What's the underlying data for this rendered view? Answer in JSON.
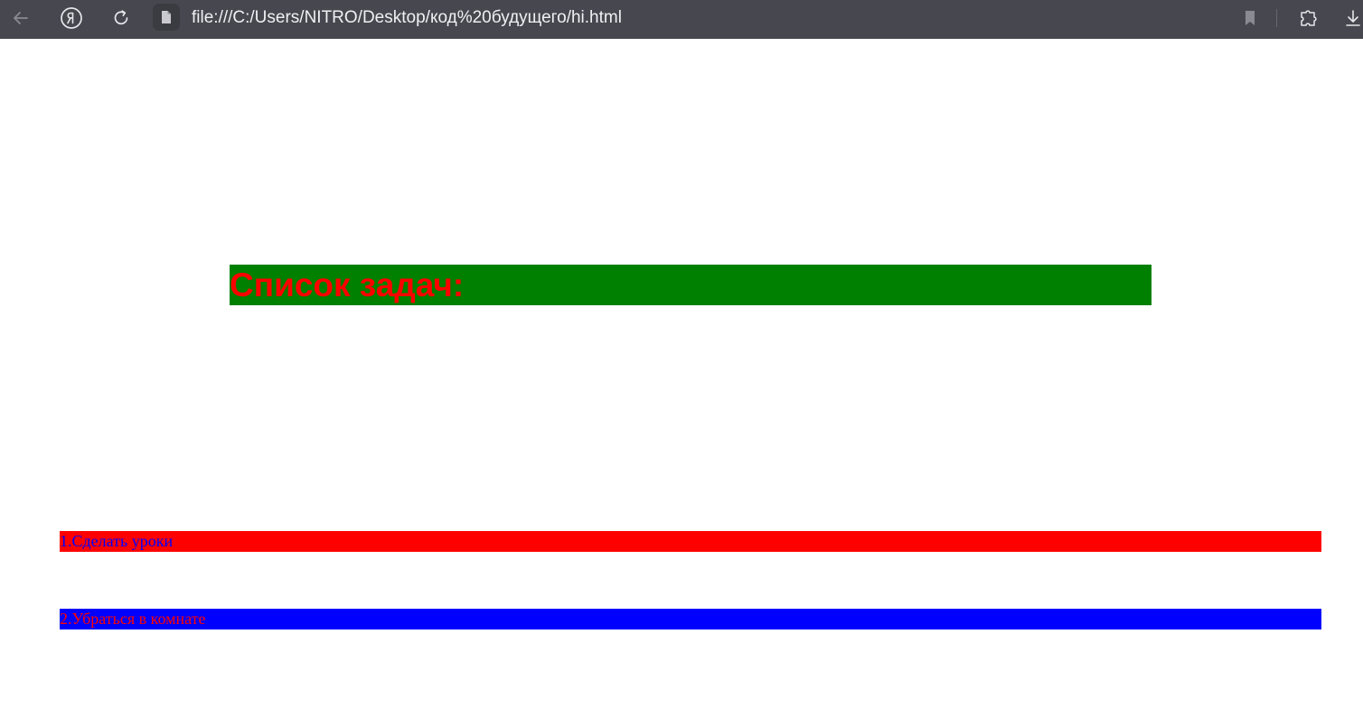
{
  "browser": {
    "address_bar": {
      "url": "file:///C:/Users/NITRO/Desktop/код%20будущего/hi.html"
    },
    "icons": {
      "back": "arrow-left-icon",
      "yandex": "yandex-logo-icon",
      "reload": "reload-icon",
      "page": "file-icon",
      "bookmark": "bookmark-icon",
      "extension": "extension-icon",
      "download": "download-icon"
    },
    "colors": {
      "toolbar_bg": "#47474f",
      "toolbar_text": "#e6e6ea"
    }
  },
  "page": {
    "heading": "Список задач:",
    "heading_colors": {
      "text": "#ff0000",
      "background": "#008000"
    },
    "tasks": [
      {
        "text": "1.Сделать уроки",
        "color": "#0000ff",
        "background": "#ff0000"
      },
      {
        "text": "2.Убраться в комнате",
        "color": "#ff0000",
        "background": "#0000ff"
      }
    ]
  }
}
